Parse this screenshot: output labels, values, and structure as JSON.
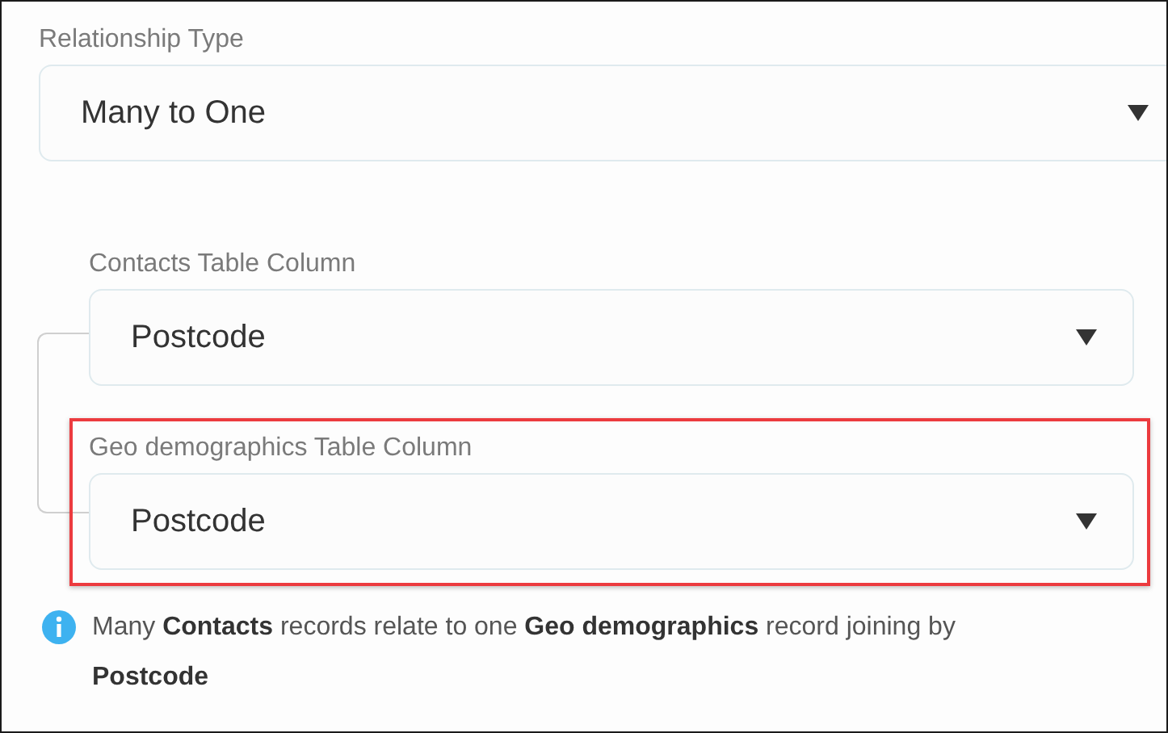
{
  "relationship_type": {
    "label": "Relationship Type",
    "value": "Many to One"
  },
  "columns": [
    {
      "label": "Contacts Table Column",
      "value": "Postcode",
      "highlighted": false
    },
    {
      "label": "Geo demographics Table Column",
      "value": "Postcode",
      "highlighted": true
    }
  ],
  "note": "Many **Contacts** records relate to one **Geo demographics** record joining by **Postcode**"
}
